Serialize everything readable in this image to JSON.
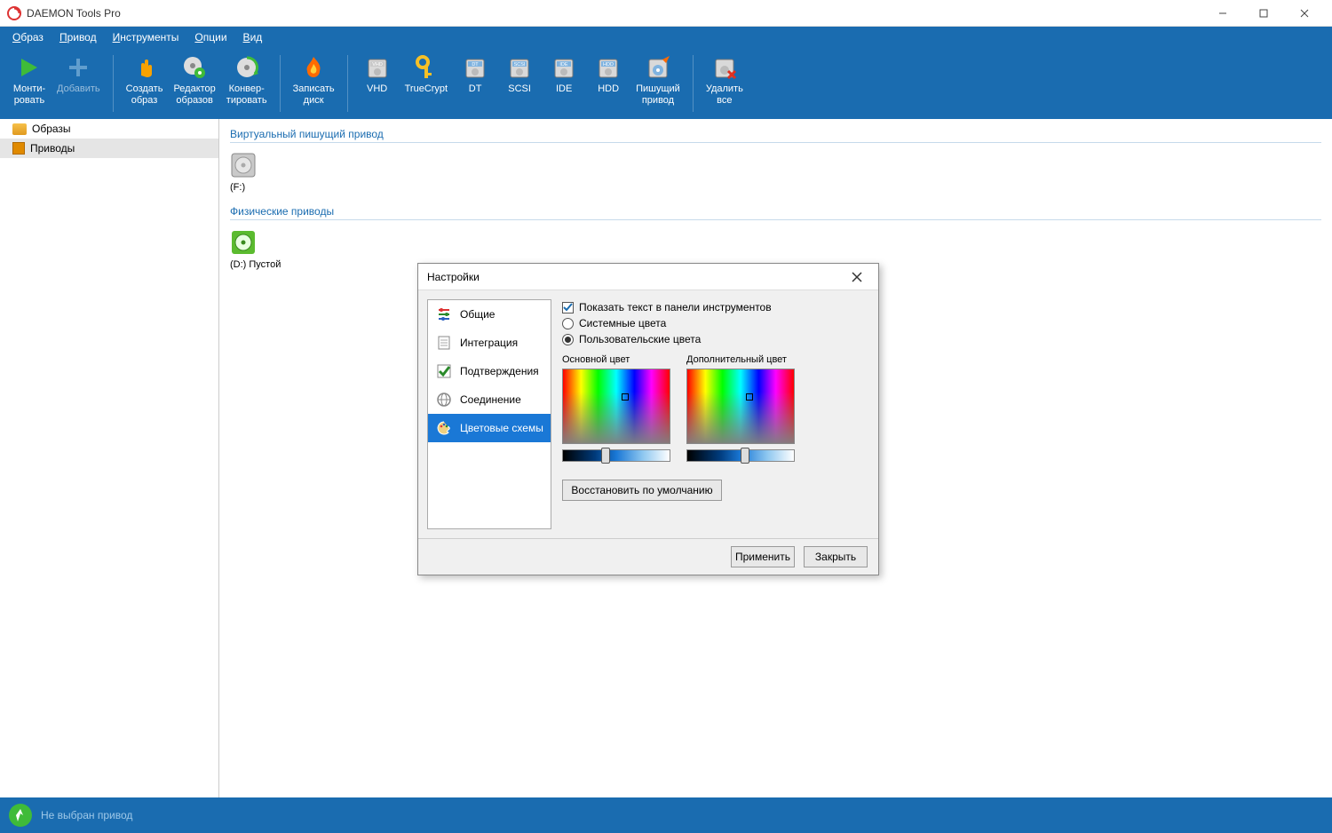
{
  "app": {
    "title": "DAEMON Tools Pro"
  },
  "menu": {
    "items": [
      "Образ",
      "Привод",
      "Инструменты",
      "Опции",
      "Вид"
    ]
  },
  "toolbar": {
    "groups": [
      [
        {
          "l1": "Монти-",
          "l2": "ровать",
          "icon": "play",
          "color": "#3fbb39"
        },
        {
          "l1": "Добавить",
          "l2": "",
          "icon": "plus",
          "color": "#9cc8e8",
          "disabled": true
        }
      ],
      [
        {
          "l1": "Создать",
          "l2": "образ",
          "icon": "hand",
          "color": "#f8a200"
        },
        {
          "l1": "Редактор",
          "l2": "образов",
          "icon": "disc-gear",
          "color": "#d0d0d0"
        },
        {
          "l1": "Конвер-",
          "l2": "тировать",
          "icon": "disc-reload",
          "color": "#d0d0d0"
        }
      ],
      [
        {
          "l1": "Записать",
          "l2": "диск",
          "icon": "flame",
          "color": "#ff7a00"
        }
      ],
      [
        {
          "l1": "VHD",
          "l2": "",
          "icon": "hdd-label",
          "label": "VHD",
          "color": "#c9c9c9"
        },
        {
          "l1": "TrueCrypt",
          "l2": "",
          "icon": "key",
          "color": "#f6c027"
        },
        {
          "l1": "DT",
          "l2": "",
          "icon": "hdd-label",
          "label": "DT",
          "color": "#7fb3e0"
        },
        {
          "l1": "SCSI",
          "l2": "",
          "icon": "hdd-label",
          "label": "SCSI",
          "color": "#7fb3e0"
        },
        {
          "l1": "IDE",
          "l2": "",
          "icon": "hdd-label",
          "label": "IDE",
          "color": "#7fb3e0"
        },
        {
          "l1": "HDD",
          "l2": "",
          "icon": "hdd-label",
          "label": "HDD",
          "color": "#7fb3e0"
        },
        {
          "l1": "Пишущий",
          "l2": "привод",
          "icon": "disc-write",
          "color": "#7fb3e0"
        }
      ],
      [
        {
          "l1": "Удалить",
          "l2": "все",
          "icon": "hdd-x",
          "color": "#c9c9c9"
        }
      ]
    ]
  },
  "sidebar": {
    "items": [
      {
        "label": "Образы",
        "selected": false,
        "icon": "folder"
      },
      {
        "label": "Приводы",
        "selected": true,
        "icon": "drive"
      }
    ]
  },
  "content": {
    "groups": [
      {
        "title": "Виртуальный пишущий привод",
        "items": [
          {
            "label": "(F:)",
            "icon": "virt"
          }
        ]
      },
      {
        "title": "Физические приводы",
        "items": [
          {
            "label": "(D:) Пустой",
            "icon": "phys"
          }
        ]
      }
    ]
  },
  "status": {
    "text": "Не выбран привод"
  },
  "dialog": {
    "title": "Настройки",
    "nav": [
      {
        "label": "Общие",
        "icon": "sliders"
      },
      {
        "label": "Интеграция",
        "icon": "doc"
      },
      {
        "label": "Подтверждения",
        "icon": "check"
      },
      {
        "label": "Соединение",
        "icon": "globe"
      },
      {
        "label": "Цветовые схемы",
        "icon": "palette",
        "selected": true
      }
    ],
    "opts": {
      "show_text": "Показать текст в панели инструментов",
      "sys_colors": "Системные цвета",
      "user_colors": "Пользовательские цвета",
      "primary": "Основной цвет",
      "secondary": "Дополнительный цвет",
      "restore": "Восстановить по умолчанию"
    },
    "hue_thumb_pos": {
      "primary": "36%",
      "secondary": "50%"
    },
    "buttons": {
      "apply": "Применить",
      "close": "Закрыть"
    }
  }
}
